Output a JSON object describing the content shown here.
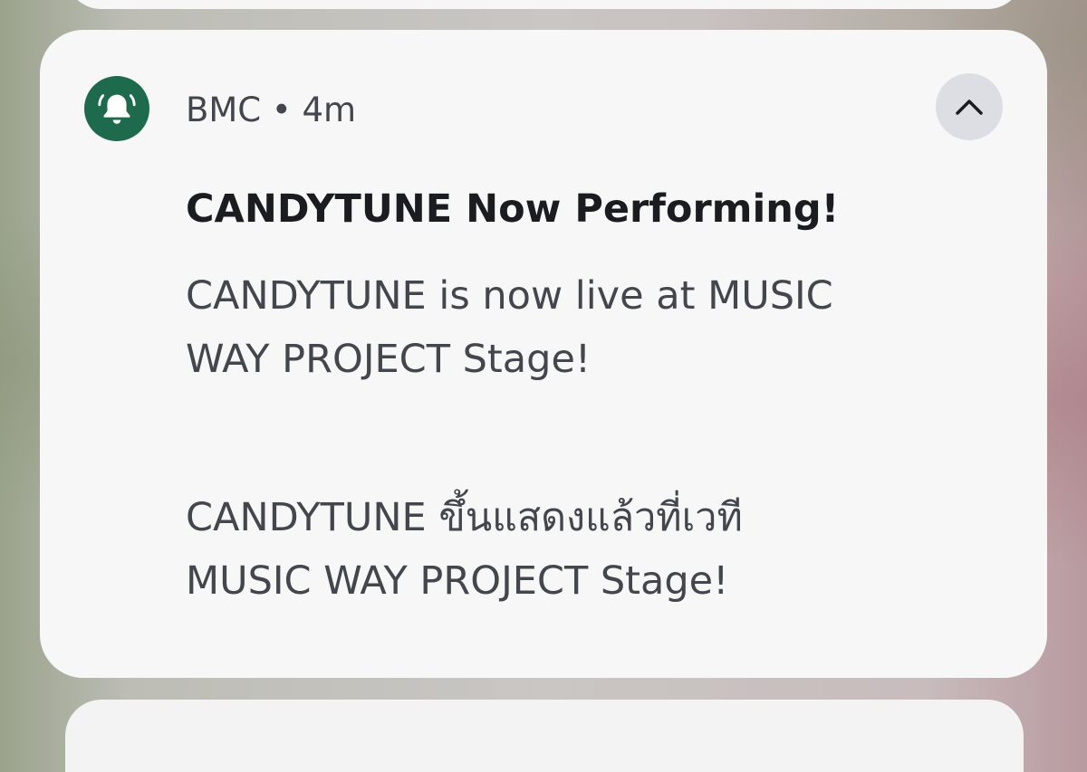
{
  "notification": {
    "app_icon": "bell-icon",
    "app_name": "BMC",
    "separator": "•",
    "time": "4m",
    "header": "BMC • 4m",
    "expand_icon": "chevron-up-icon",
    "title": "CANDYTUNE Now Performing!",
    "body_en": [
      "CANDYTUNE is now live at MUSIC",
      "WAY PROJECT Stage!"
    ],
    "body_th": [
      "CANDYTUNE ขึ้นแสดงแล้วที่เวที",
      "MUSIC WAY PROJECT Stage!"
    ]
  },
  "colors": {
    "icon_bg": "#1d6b4c",
    "card_bg": "#f7f7f8",
    "title": "#1b1c20",
    "body": "#44464d",
    "button_bg": "#dddde4"
  }
}
